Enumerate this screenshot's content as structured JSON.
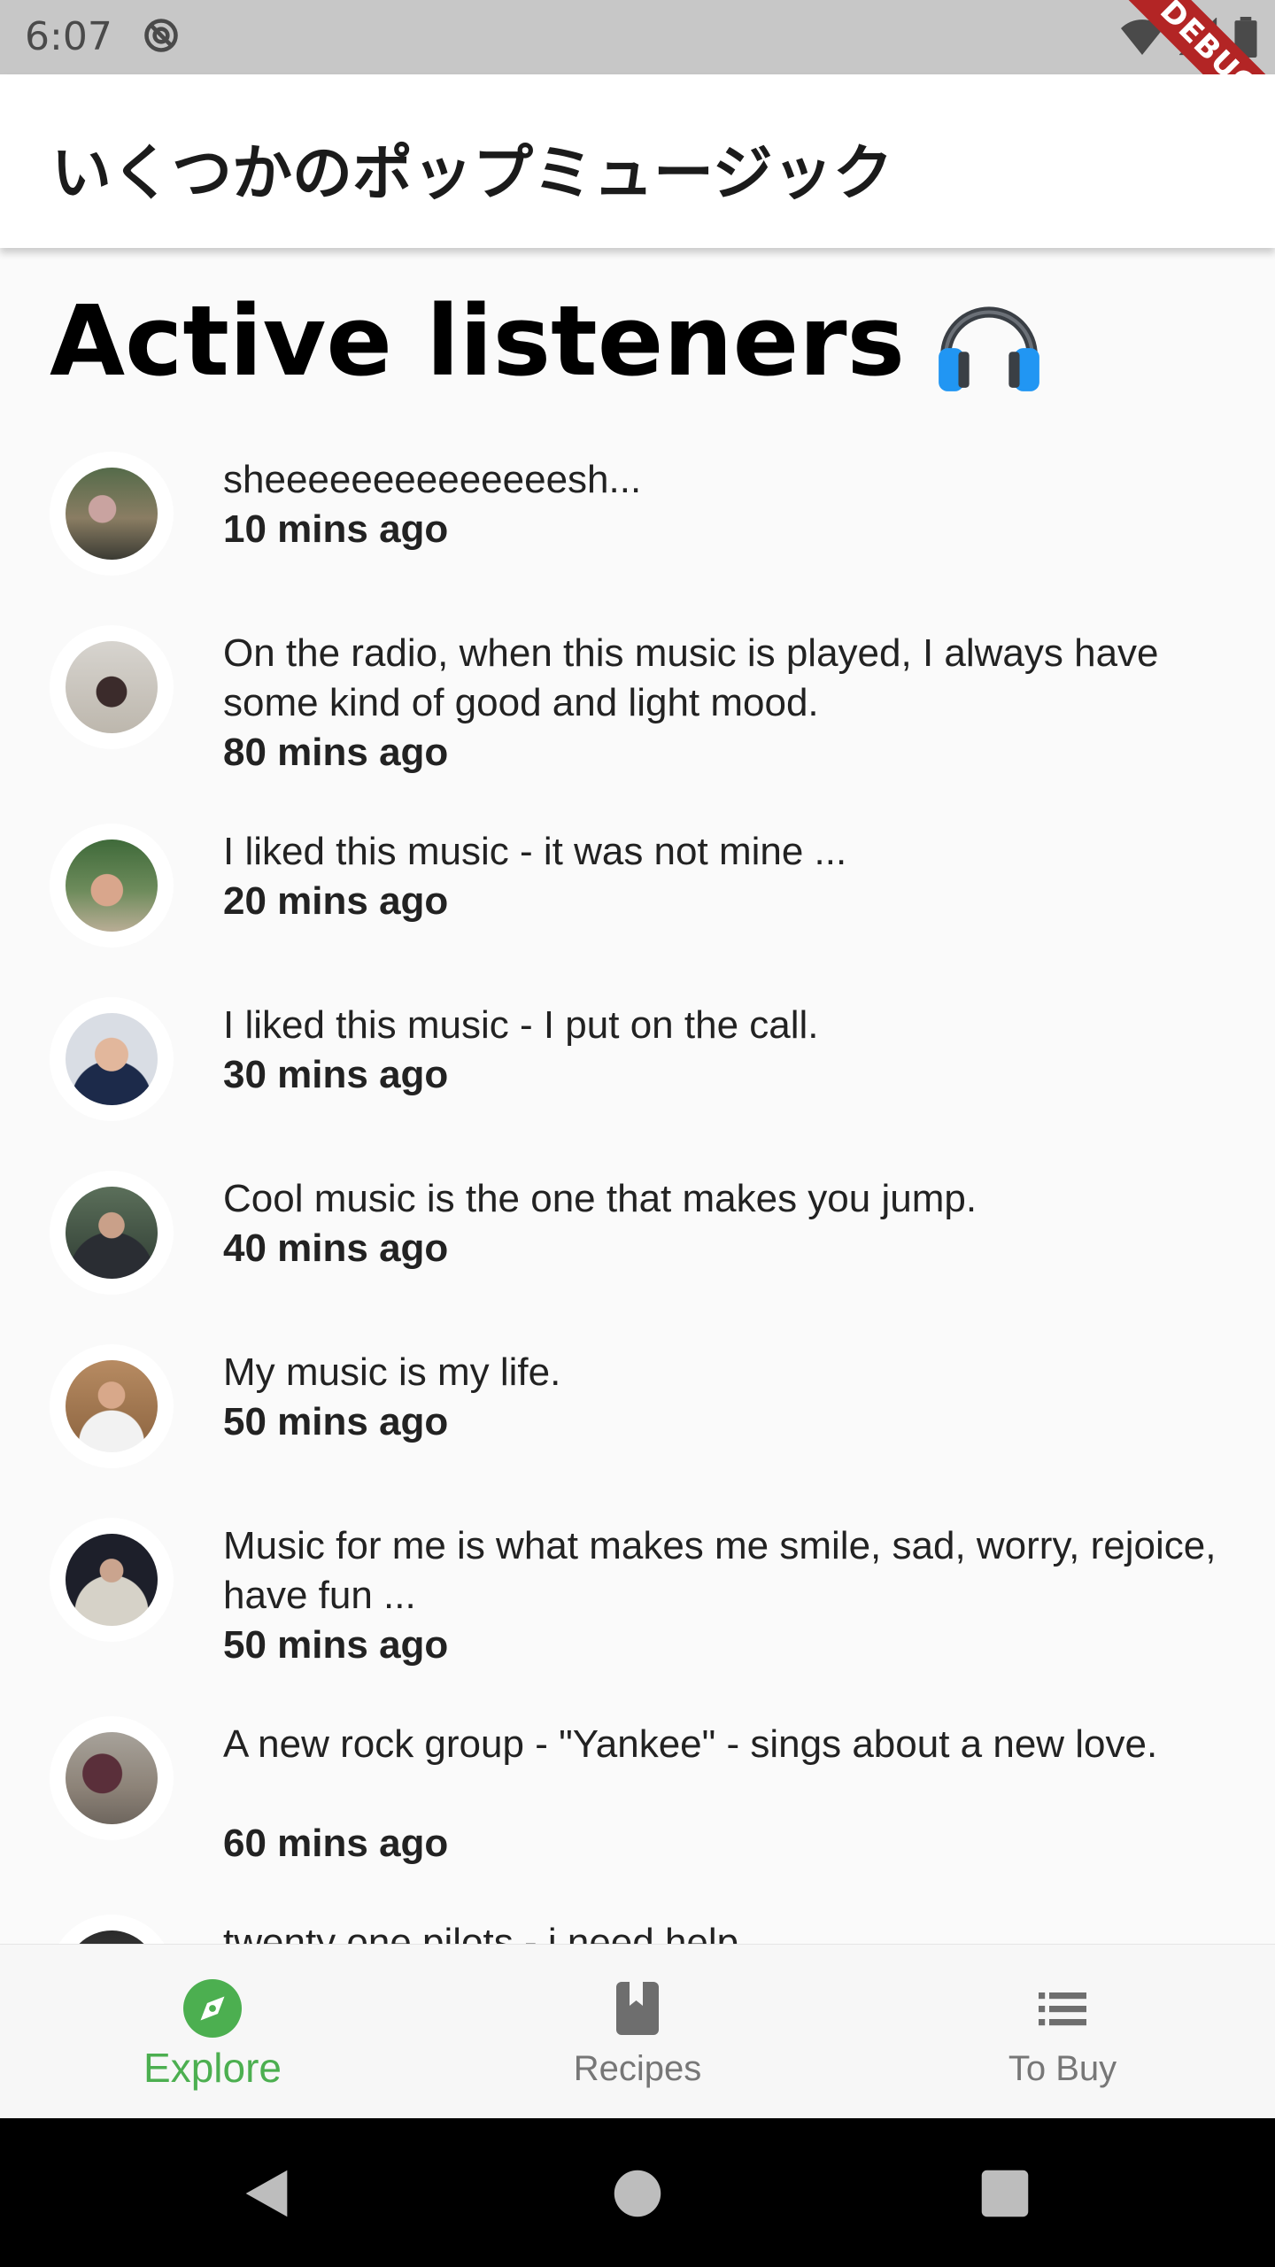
{
  "status_bar": {
    "time": "6:07",
    "debug_label": "DEBUG"
  },
  "app_bar": {
    "title": "いくつかのポップミュージック"
  },
  "section": {
    "title": "Active listeners"
  },
  "comments": [
    {
      "text": "sheeeeeeeeeeeeeesh...",
      "time": "10 mins ago"
    },
    {
      "text": "On the radio, when this music is played, I always have some kind of good and light mood.",
      "time": "80 mins ago"
    },
    {
      "text": "I liked this music - it was not mine ...",
      "time": "20 mins ago"
    },
    {
      "text": "I liked this music - I put on the call.",
      "time": "30 mins ago"
    },
    {
      "text": "Cool music is the one that makes you jump.",
      "time": "40 mins ago"
    },
    {
      "text": "My music is my life.",
      "time": "50 mins ago"
    },
    {
      "text": "Music for me is what makes me smile, sad, worry, rejoice, have fun ...",
      "time": "50 mins ago"
    },
    {
      "text": "A new rock group - \"Yankee\" - sings about a new love.",
      "time": "60 mins ago"
    },
    {
      "text": "twenty one pilots - i need help",
      "time": ""
    }
  ],
  "bottom_nav": {
    "items": [
      {
        "label": "Explore",
        "icon": "compass-icon",
        "active": true
      },
      {
        "label": "Recipes",
        "icon": "book-icon",
        "active": false
      },
      {
        "label": "To Buy",
        "icon": "list-icon",
        "active": false
      }
    ]
  },
  "colors": {
    "accent": "#4caf50",
    "debug": "#b32525",
    "status_bar": "#c7c7c7"
  }
}
